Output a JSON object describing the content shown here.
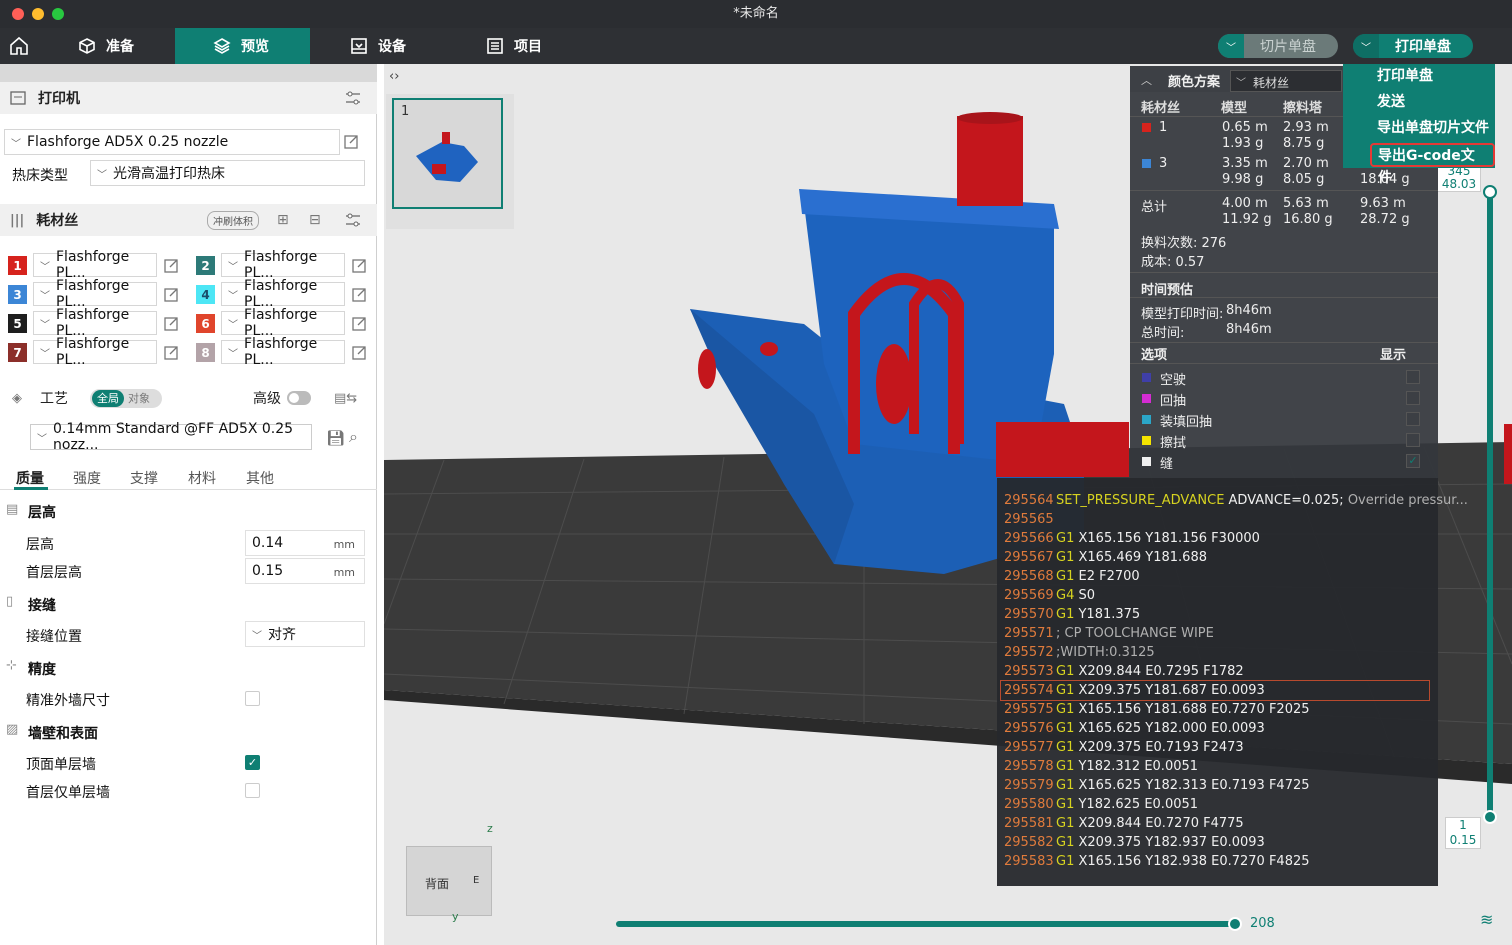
{
  "window": {
    "title": "*未命名"
  },
  "tabs": [
    {
      "label": "准备"
    },
    {
      "label": "预览"
    },
    {
      "label": "设备"
    },
    {
      "label": "项目"
    }
  ],
  "top_buttons": {
    "slice": "切片单盘",
    "print": "打印单盘"
  },
  "print_menu": [
    "打印单盘",
    "发送",
    "导出单盘切片文件",
    "导出G-code文件"
  ],
  "printer": {
    "section": "打印机",
    "name": "Flashforge AD5X 0.25 nozzle",
    "bed_label": "热床类型",
    "bed_value": "光滑高温打印热床"
  },
  "filament": {
    "section": "耗材丝",
    "flush_label": "冲刷体积",
    "items": [
      {
        "num": "1",
        "color": "#d6231d",
        "name": "Flashforge PL..."
      },
      {
        "num": "2",
        "color": "#2d7a78",
        "name": "Flashforge PL..."
      },
      {
        "num": "3",
        "color": "#3c86d6",
        "name": "Flashforge PL..."
      },
      {
        "num": "4",
        "color": "#4de6f5",
        "name": "Flashforge PL..."
      },
      {
        "num": "5",
        "color": "#1e1e1e",
        "name": "Flashforge PL..."
      },
      {
        "num": "6",
        "color": "#e0452c",
        "name": "Flashforge PL..."
      },
      {
        "num": "7",
        "color": "#8c2f2a",
        "name": "Flashforge PL..."
      },
      {
        "num": "8",
        "color": "#b3a3a8",
        "name": "Flashforge PL..."
      }
    ]
  },
  "process": {
    "section": "工艺",
    "global": "全局",
    "object": "对象",
    "advanced": "高级",
    "preset": "0.14mm Standard @FF AD5X 0.25 nozz...",
    "subtabs": [
      "质量",
      "强度",
      "支撑",
      "材料",
      "其他"
    ],
    "groups": {
      "layer": "层高",
      "seam": "接缝",
      "precision": "精度",
      "walls": "墙壁和表面"
    },
    "layer_height": {
      "label": "层高",
      "value": "0.14",
      "unit": "mm"
    },
    "first_layer_height": {
      "label": "首层层高",
      "value": "0.15",
      "unit": "mm"
    },
    "seam_position": {
      "label": "接缝位置",
      "value": "对齐"
    },
    "precise_wall": {
      "label": "精准外墙尺寸",
      "checked": false
    },
    "top_single_wall": {
      "label": "顶面单层墙",
      "checked": true
    },
    "first_single_wall": {
      "label": "首层仅单层墙",
      "checked": false
    }
  },
  "plate": {
    "number": "1"
  },
  "legend": {
    "scheme_label": "颜色方案",
    "scheme_value": "耗材丝",
    "headers": [
      "耗材丝",
      "模型",
      "擦料塔"
    ],
    "rows": [
      {
        "id": "1",
        "color": "#d6231d",
        "model_len": "0.65 m",
        "model_wt": "1.93 g",
        "tower_len": "2.93 m",
        "tower_wt": "8.75 g",
        "total_len": "",
        "total_wt": ""
      },
      {
        "id": "3",
        "color": "#3c86d6",
        "model_len": "3.35 m",
        "model_wt": "9.98 g",
        "tower_len": "2.70 m",
        "tower_wt": "8.05 g",
        "total_len": "",
        "total_wt": "18.04 g"
      }
    ],
    "total": {
      "label": "总计",
      "model_len": "4.00 m",
      "model_wt": "11.92 g",
      "tower_len": "5.63 m",
      "tower_wt": "16.80 g",
      "sum_len": "9.63 m",
      "sum_wt": "28.72 g"
    },
    "changes": "换料次数: 276",
    "cost": "成本: 0.57",
    "time_title": "时间预估",
    "model_time_label": "模型打印时间:",
    "model_time": "8h46m",
    "total_time_label": "总时间:",
    "total_time": "8h46m",
    "options_title": "选项",
    "display_title": "显示",
    "options": [
      {
        "label": "空驶",
        "color": "#3f3fa8",
        "checked": false
      },
      {
        "label": "回抽",
        "color": "#d42cd2",
        "checked": false
      },
      {
        "label": "装填回抽",
        "color": "#2ba6c8",
        "checked": false
      },
      {
        "label": "擦拭",
        "color": "#f5e400",
        "checked": false
      },
      {
        "label": "缝",
        "color": "#f0f0f0",
        "checked": true
      }
    ]
  },
  "gcode": [
    {
      "n": "295564",
      "c": "SET_PRESSURE_ADVANCE",
      "a": " ADVANCE=0.025;",
      "cm": " Override pressur..."
    },
    {
      "n": "295565",
      "c": "",
      "a": "",
      "cm": ""
    },
    {
      "n": "295566",
      "c": "G1",
      "a": " X165.156 Y181.156 F30000",
      "cm": ""
    },
    {
      "n": "295567",
      "c": "G1",
      "a": " X165.469 Y181.688",
      "cm": ""
    },
    {
      "n": "295568",
      "c": "G1",
      "a": " E2 F2700",
      "cm": ""
    },
    {
      "n": "295569",
      "c": "G4",
      "a": " S0",
      "cm": ""
    },
    {
      "n": "295570",
      "c": "G1",
      "a": " Y181.375",
      "cm": ""
    },
    {
      "n": "295571",
      "c": "",
      "a": "",
      "cm": "; CP TOOLCHANGE WIPE"
    },
    {
      "n": "295572",
      "c": "",
      "a": "",
      "cm": ";WIDTH:0.3125"
    },
    {
      "n": "295573",
      "c": "G1",
      "a": " X209.844 E0.7295 F1782",
      "cm": ""
    },
    {
      "n": "295574",
      "c": "G1",
      "a": " X209.375 Y181.687 E0.0093",
      "cm": ""
    },
    {
      "n": "295575",
      "c": "G1",
      "a": " X165.156 Y181.688 E0.7270 F2025",
      "cm": ""
    },
    {
      "n": "295576",
      "c": "G1",
      "a": " X165.625 Y182.000 E0.0093",
      "cm": ""
    },
    {
      "n": "295577",
      "c": "G1",
      "a": " X209.375 E0.7193 F2473",
      "cm": ""
    },
    {
      "n": "295578",
      "c": "G1",
      "a": " Y182.312 E0.0051",
      "cm": ""
    },
    {
      "n": "295579",
      "c": "G1",
      "a": " X165.625 Y182.313 E0.7193 F4725",
      "cm": ""
    },
    {
      "n": "295580",
      "c": "G1",
      "a": " Y182.625 E0.0051",
      "cm": ""
    },
    {
      "n": "295581",
      "c": "G1",
      "a": " X209.844 E0.7270 F4775",
      "cm": ""
    },
    {
      "n": "295582",
      "c": "G1",
      "a": " X209.375 Y182.937 E0.0093",
      "cm": ""
    },
    {
      "n": "295583",
      "c": "G1",
      "a": " X165.156 Y182.938 E0.7270 F4825",
      "cm": ""
    }
  ],
  "layer_slider": {
    "top_value": "48.03",
    "top_partial": "345",
    "bottom_layer": "1",
    "bottom_height": "0.15"
  },
  "move_slider": {
    "value": "208"
  },
  "view_cube": {
    "face": "背面",
    "axis_z": "z",
    "axis_y": "y",
    "axis_e": "E"
  },
  "colors": {
    "accent": "#0f7f73",
    "model_blue": "#1a5fb4",
    "model_red": "#c4161c"
  }
}
